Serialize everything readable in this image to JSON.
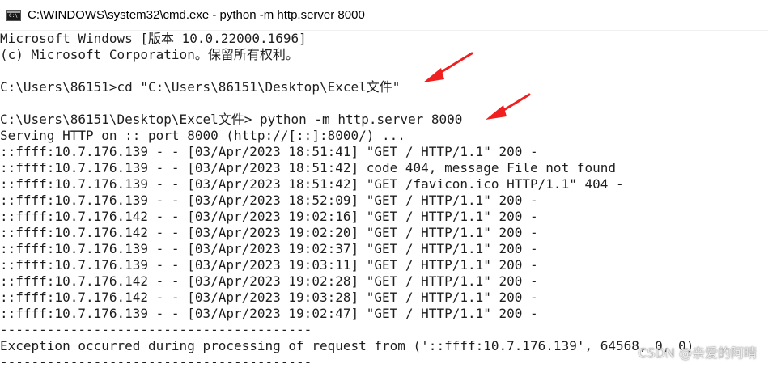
{
  "window": {
    "title": "C:\\WINDOWS\\system32\\cmd.exe - python  -m http.server 8000",
    "icon": "cmd-icon"
  },
  "console": {
    "lines": [
      "Microsoft Windows [版本 10.0.22000.1696]",
      "(c) Microsoft Corporation。保留所有权利。",
      "",
      "C:\\Users\\86151>cd \"C:\\Users\\86151\\Desktop\\Excel文件\"",
      "",
      "C:\\Users\\86151\\Desktop\\Excel文件> python -m http.server 8000",
      "Serving HTTP on :: port 8000 (http://[::]:8000/) ...",
      "::ffff:10.7.176.139 - - [03/Apr/2023 18:51:41] \"GET / HTTP/1.1\" 200 -",
      "::ffff:10.7.176.139 - - [03/Apr/2023 18:51:42] code 404, message File not found",
      "::ffff:10.7.176.139 - - [03/Apr/2023 18:51:42] \"GET /favicon.ico HTTP/1.1\" 404 -",
      "::ffff:10.7.176.139 - - [03/Apr/2023 18:52:09] \"GET / HTTP/1.1\" 200 -",
      "::ffff:10.7.176.142 - - [03/Apr/2023 19:02:16] \"GET / HTTP/1.1\" 200 -",
      "::ffff:10.7.176.142 - - [03/Apr/2023 19:02:20] \"GET / HTTP/1.1\" 200 -",
      "::ffff:10.7.176.139 - - [03/Apr/2023 19:02:37] \"GET / HTTP/1.1\" 200 -",
      "::ffff:10.7.176.139 - - [03/Apr/2023 19:03:11] \"GET / HTTP/1.1\" 200 -",
      "::ffff:10.7.176.142 - - [03/Apr/2023 19:02:28] \"GET / HTTP/1.1\" 200 -",
      "::ffff:10.7.176.142 - - [03/Apr/2023 19:03:28] \"GET / HTTP/1.1\" 200 -",
      "::ffff:10.7.176.139 - - [03/Apr/2023 19:02:47] \"GET / HTTP/1.1\" 200 -",
      "----------------------------------------",
      "Exception occurred during processing of request from ('::ffff:10.7.176.139', 64568, 0, 0)",
      "----------------------------------------"
    ]
  },
  "annotations": {
    "arrow_color": "#f02020"
  },
  "watermark": "CSDN @亲爱的阿晴"
}
